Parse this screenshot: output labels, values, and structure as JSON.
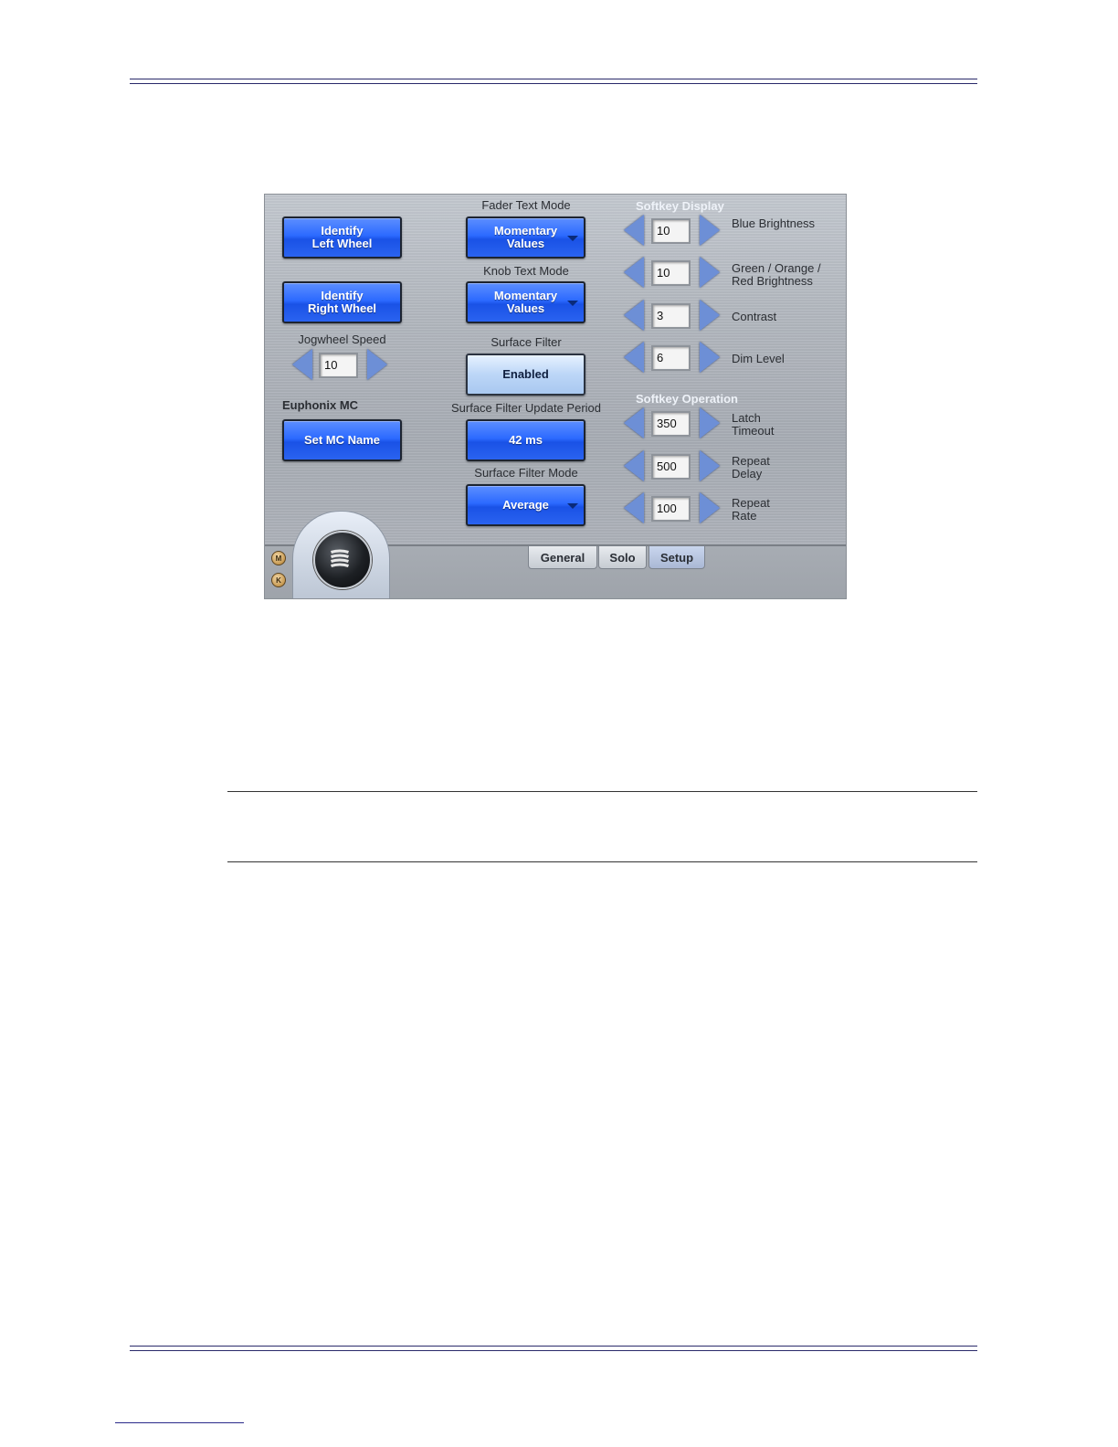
{
  "left_column": {
    "identify_left_line1": "Identify",
    "identify_left_line2": "Left Wheel",
    "identify_right_line1": "Identify",
    "identify_right_line2": "Right Wheel",
    "jogwheel_speed_label": "Jogwheel Speed",
    "jogwheel_speed_value": "10",
    "euphonix_label": "Euphonix MC",
    "set_mc_name": "Set MC Name"
  },
  "middle_column": {
    "fader_text_mode_label": "Fader Text Mode",
    "fader_text_mode_line1": "Momentary",
    "fader_text_mode_line2": "Values",
    "knob_text_mode_label": "Knob Text Mode",
    "knob_text_mode_line1": "Momentary",
    "knob_text_mode_line2": "Values",
    "surface_filter_label": "Surface Filter",
    "surface_filter_value": "Enabled",
    "update_period_label": "Surface Filter Update Period",
    "update_period_value": "42 ms",
    "filter_mode_label": "Surface Filter Mode",
    "filter_mode_value": "Average"
  },
  "softkey_display": {
    "title": "Softkey Display",
    "rows": [
      {
        "value": "10",
        "label1": "Blue Brightness",
        "label2": ""
      },
      {
        "value": "10",
        "label1": "Green / Orange /",
        "label2": "Red Brightness"
      },
      {
        "value": "3",
        "label1": "Contrast",
        "label2": ""
      },
      {
        "value": "6",
        "label1": "Dim Level",
        "label2": ""
      }
    ]
  },
  "softkey_operation": {
    "title": "Softkey Operation",
    "rows": [
      {
        "value": "350",
        "label1": "Latch",
        "label2": "Timeout"
      },
      {
        "value": "500",
        "label1": "Repeat",
        "label2": "Delay"
      },
      {
        "value": "100",
        "label1": "Repeat",
        "label2": "Rate"
      }
    ]
  },
  "tabs": [
    {
      "label": "General",
      "active": false
    },
    {
      "label": "Solo",
      "active": false
    },
    {
      "label": "Setup",
      "active": true
    }
  ],
  "mode_buttons": {
    "m": "M",
    "k": "K"
  },
  "colors": {
    "button_blue": "#2c6aff",
    "button_light": "#bcd6f7",
    "arrow_blue": "#6d8fd6"
  }
}
